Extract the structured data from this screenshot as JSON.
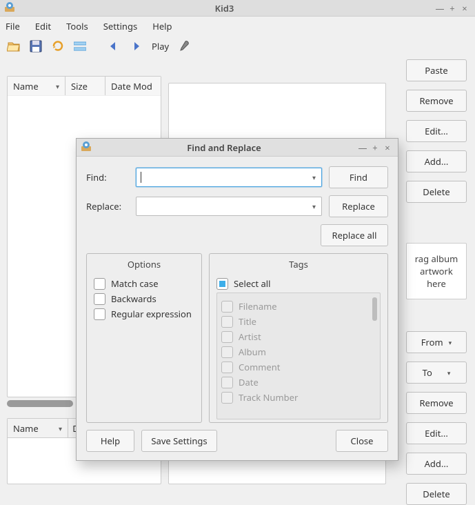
{
  "window": {
    "title": "Kid3",
    "controls": {
      "min": "—",
      "max": "+",
      "close": "×"
    }
  },
  "menu": [
    "File",
    "Edit",
    "Tools",
    "Settings",
    "Help"
  ],
  "toolbar": {
    "play_label": "Play"
  },
  "file_headers": {
    "name": "Name",
    "size": "Size",
    "date": "Date Mod"
  },
  "right_buttons_top": [
    "Paste",
    "Remove",
    "Edit...",
    "Add...",
    "Delete"
  ],
  "artwork_hint": "Drag album artwork here",
  "from_label": "From",
  "to_label": "To",
  "right_buttons_bottom": [
    "Remove",
    "Edit...",
    "Add...",
    "Delete"
  ],
  "lower_table": {
    "name": "Name",
    "col2": "D"
  },
  "dialog": {
    "title": "Find and Replace",
    "controls": {
      "min": "—",
      "max": "+",
      "close": "×"
    },
    "find_label": "Find:",
    "find_value": "",
    "replace_label": "Replace:",
    "replace_value": "",
    "find_btn": "Find",
    "replace_btn": "Replace",
    "replace_all_btn": "Replace all",
    "options_legend": "Options",
    "options": [
      "Match case",
      "Backwards",
      "Regular expression"
    ],
    "tags_legend": "Tags",
    "select_all": "Select all",
    "tag_items": [
      "Filename",
      "Title",
      "Artist",
      "Album",
      "Comment",
      "Date",
      "Track Number"
    ],
    "help_btn": "Help",
    "save_btn": "Save Settings",
    "close_btn": "Close"
  }
}
